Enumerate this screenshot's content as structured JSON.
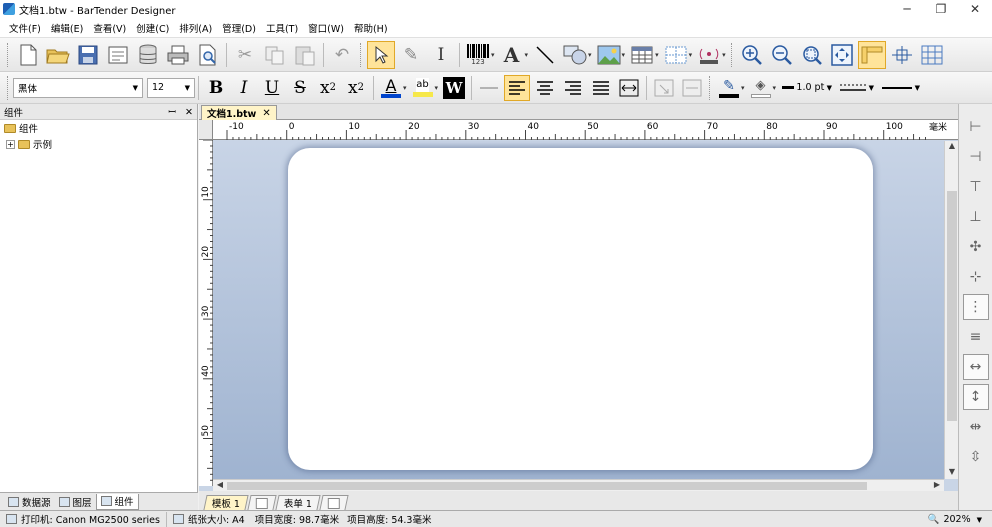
{
  "window": {
    "title": "文档1.btw - BarTender Designer",
    "minimize": "─",
    "maximize": "❐",
    "close": "✕"
  },
  "menu": [
    "文件(F)",
    "编辑(E)",
    "查看(V)",
    "创建(C)",
    "排列(A)",
    "管理(D)",
    "工具(T)",
    "窗口(W)",
    "帮助(H)"
  ],
  "toolbar_icons": [
    "new-document-icon",
    "open-folder-icon",
    "save-icon",
    "page-setup-icon",
    "database-icon",
    "print-icon",
    "print-preview-icon",
    "cut-icon",
    "copy-icon",
    "paste-icon",
    "undo-icon",
    "pointer-icon",
    "format-painter-icon",
    "text-cursor-icon",
    "barcode-icon",
    "text-icon",
    "line-icon",
    "shape-icon",
    "picture-icon",
    "table-icon",
    "grid-icon",
    "rfid-icon",
    "zoom-in-icon",
    "zoom-out-icon",
    "zoom-fit-icon",
    "zoom-page-icon",
    "ruler-icon",
    "align-grid-icon",
    "grid-toggle-icon"
  ],
  "barcode_sub": "123",
  "format": {
    "font": "黑体",
    "size": "12",
    "bold": "B",
    "italic": "I",
    "underline": "U",
    "strike": "S",
    "subscript_base": "x",
    "subscript": "2",
    "superscript_base": "x",
    "superscript": "2",
    "font_color": "A",
    "highlight": "ab",
    "word_art": "W",
    "line_weight": "1.0 pt"
  },
  "panel": {
    "title": "组件",
    "pin": "ꟷ",
    "close": "✕",
    "tree": [
      {
        "label": "组件",
        "level": 0
      },
      {
        "label": "示例",
        "level": 1,
        "expander": "+"
      }
    ],
    "tabs": [
      {
        "label": "数据源",
        "active": false
      },
      {
        "label": "图层",
        "active": false
      },
      {
        "label": "组件",
        "active": true
      }
    ]
  },
  "document": {
    "tab_label": "文档1.btw",
    "tab_close": "✕",
    "ruler_h_labels": [
      "-10",
      "0",
      "10",
      "20",
      "30",
      "40",
      "50",
      "60",
      "70",
      "80",
      "90",
      "100"
    ],
    "ruler_unit": "毫米",
    "ruler_v_labels": [
      "10",
      "20",
      "30",
      "40",
      "50"
    ],
    "sheet_tabs": [
      {
        "label": "模板 1",
        "active": true
      },
      {
        "label": "表单 1",
        "active": false
      }
    ]
  },
  "status": {
    "printer": "打印机: Canon MG2500 series",
    "paper": "纸张大小: A4",
    "item_width": "项目宽度: 98.7毫米",
    "item_height": "项目高度: 54.3毫米",
    "zoom": "202%"
  },
  "colors": {
    "accent_selected": "#ffe49a",
    "canvas_bg": "#b4c4dc",
    "doc_tab": "#fff4c8"
  }
}
